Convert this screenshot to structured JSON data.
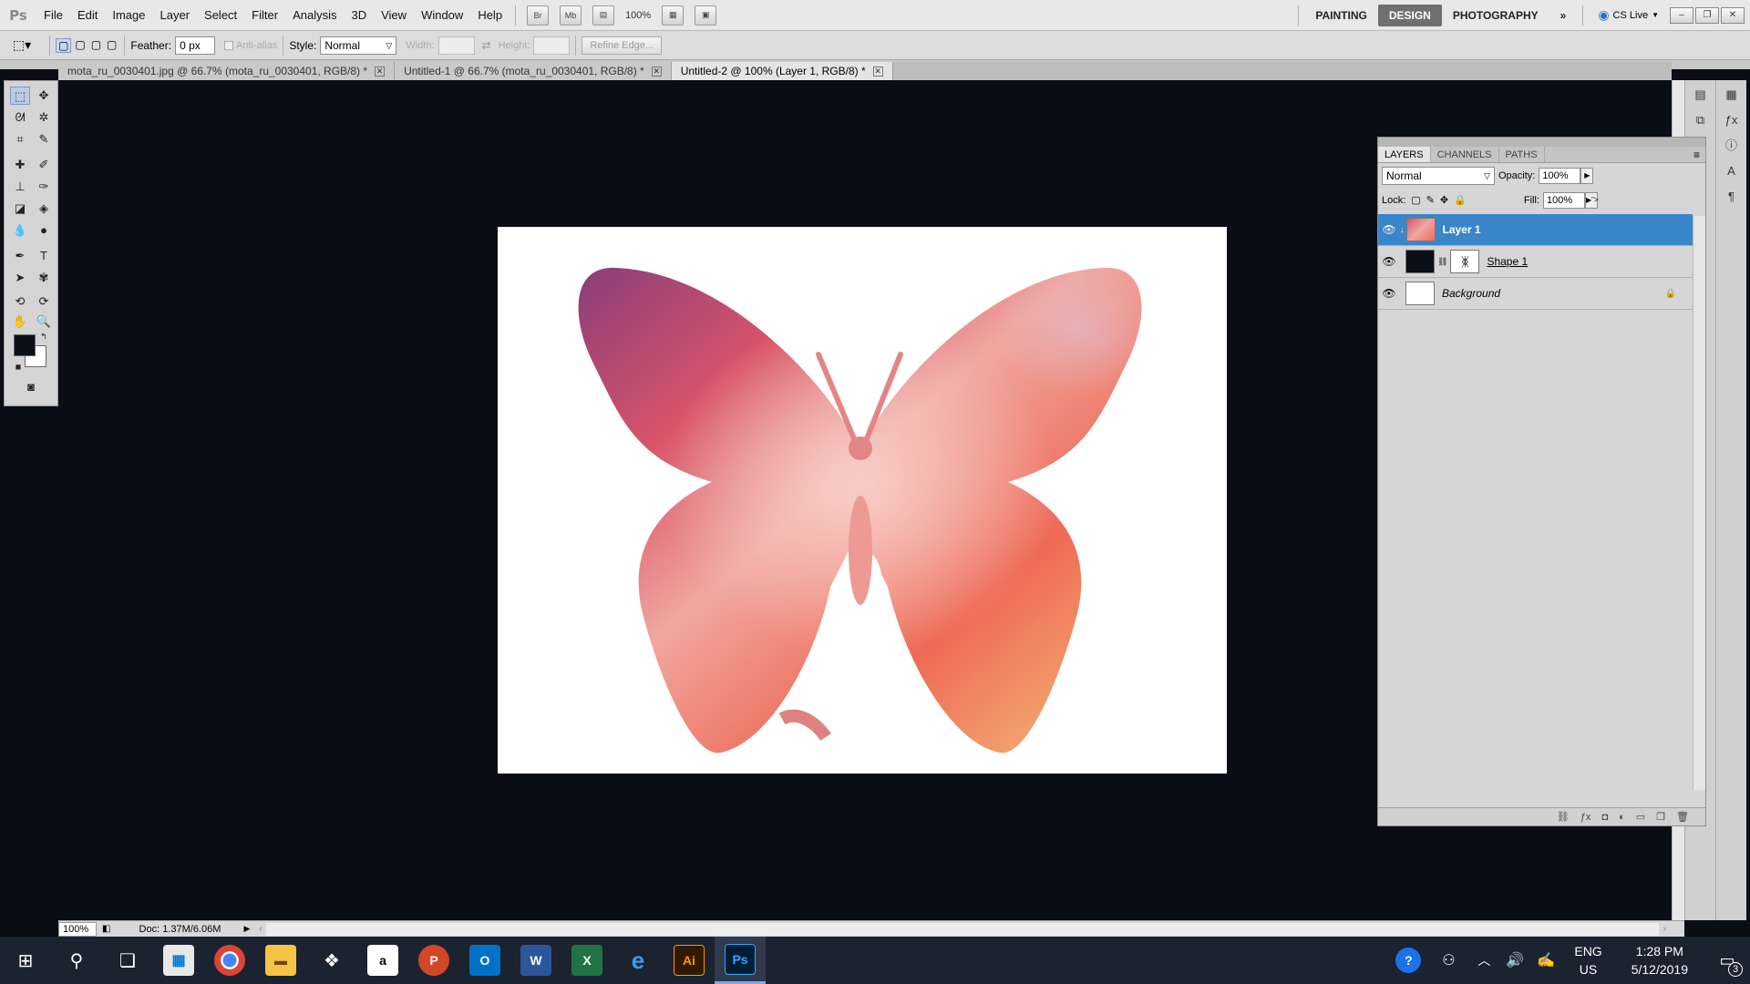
{
  "menubar": {
    "logo": "Ps",
    "items": [
      "File",
      "Edit",
      "Image",
      "Layer",
      "Select",
      "Filter",
      "Analysis",
      "3D",
      "View",
      "Window",
      "Help"
    ],
    "bridge_label": "Br",
    "minibridge_label": "Mb",
    "zoom": "100%",
    "workspaces": [
      "PAINTING",
      "DESIGN",
      "PHOTOGRAPHY"
    ],
    "active_workspace": "DESIGN",
    "cs_live": "CS Live"
  },
  "options": {
    "feather_label": "Feather:",
    "feather_value": "0 px",
    "antialias_label": "Anti-alias",
    "style_label": "Style:",
    "style_value": "Normal",
    "width_label": "Width:",
    "height_label": "Height:",
    "refine_edge": "Refine Edge..."
  },
  "tabs": [
    {
      "label": "mota_ru_0030401.jpg @ 66.7% (mota_ru_0030401, RGB/8) *",
      "active": false
    },
    {
      "label": "Untitled-1 @ 66.7% (mota_ru_0030401, RGB/8) *",
      "active": false
    },
    {
      "label": "Untitled-2 @ 100% (Layer 1, RGB/8) *",
      "active": true
    }
  ],
  "status": {
    "zoom": "100%",
    "doc": "Doc: 1.37M/6.06M"
  },
  "layers_panel": {
    "tabs": [
      "LAYERS",
      "CHANNELS",
      "PATHS"
    ],
    "blend_mode": "Normal",
    "opacity_label": "Opacity:",
    "opacity_value": "100%",
    "lock_label": "Lock:",
    "fill_label": "Fill:",
    "fill_value": "100%",
    "layers": [
      {
        "name": "Layer 1",
        "selected": true
      },
      {
        "name": "Shape 1",
        "selected": false
      },
      {
        "name": "Background",
        "selected": false
      }
    ]
  },
  "colors": {
    "canvas_bg": "#0a0d14",
    "selection": "#3a86cb",
    "foreground": "#0b0f17",
    "background": "#ffffff"
  },
  "taskbar": {
    "apps": [
      "start-icon",
      "search-icon",
      "task-view-icon",
      "store-icon",
      "chrome-icon",
      "file-explorer-icon",
      "dropbox-icon",
      "amazon-icon",
      "powerpoint-icon",
      "outlook-icon",
      "word-icon",
      "excel-icon",
      "edge-icon",
      "illustrator-icon",
      "photoshop-icon"
    ],
    "amazon_label": "a",
    "powerpoint_label": "P",
    "outlook_label": "O",
    "word_label": "W",
    "excel_label": "X",
    "edge_label": "e",
    "illustrator_label": "Ai",
    "photoshop_label": "Ps",
    "lang_top": "ENG",
    "lang_bottom": "US",
    "time": "1:28 PM",
    "date": "5/12/2019",
    "notifications": "3"
  }
}
